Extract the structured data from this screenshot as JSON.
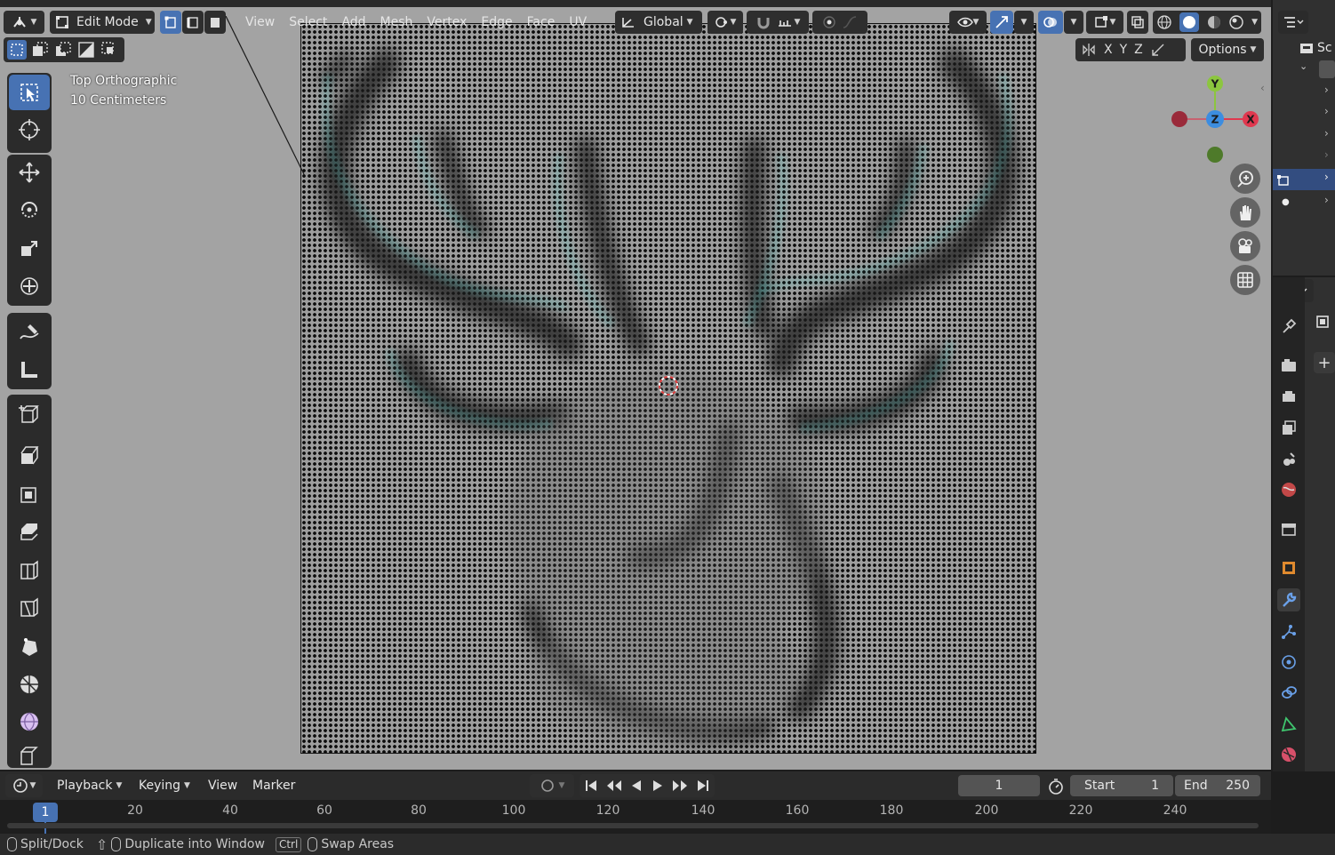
{
  "header": {
    "mode": "Edit Mode",
    "menus": [
      "View",
      "Select",
      "Add",
      "Mesh",
      "Vertex",
      "Edge",
      "Face",
      "UV"
    ],
    "transform_orientation": "Global",
    "axes": [
      "X",
      "Y",
      "Z"
    ],
    "options_label": "Options"
  },
  "viewport": {
    "view_name": "Top Orthographic",
    "scale_text": "10 Centimeters"
  },
  "gizmo": {
    "y": "Y",
    "z": "Z",
    "x": "X"
  },
  "outliner": {
    "title_fragment": "Sc"
  },
  "timeline": {
    "menus": [
      "Playback",
      "Keying",
      "View",
      "Marker"
    ],
    "current_frame": "1",
    "start_label": "Start",
    "start_value": "1",
    "end_label": "End",
    "end_value": "250",
    "ticks": [
      "1",
      "20",
      "40",
      "60",
      "80",
      "100",
      "120",
      "140",
      "160",
      "180",
      "200",
      "220",
      "240"
    ]
  },
  "statusbar": {
    "split_dock": "Split/Dock",
    "duplicate": "Duplicate into Window",
    "ctrl": "Ctrl",
    "swap": "Swap Areas"
  },
  "colors": {
    "accent": "#4772b3",
    "axis_x": "#e0384f",
    "axis_y": "#8cc63f",
    "axis_z": "#3c8de0",
    "selection_cyan": "#2ff0e8"
  }
}
